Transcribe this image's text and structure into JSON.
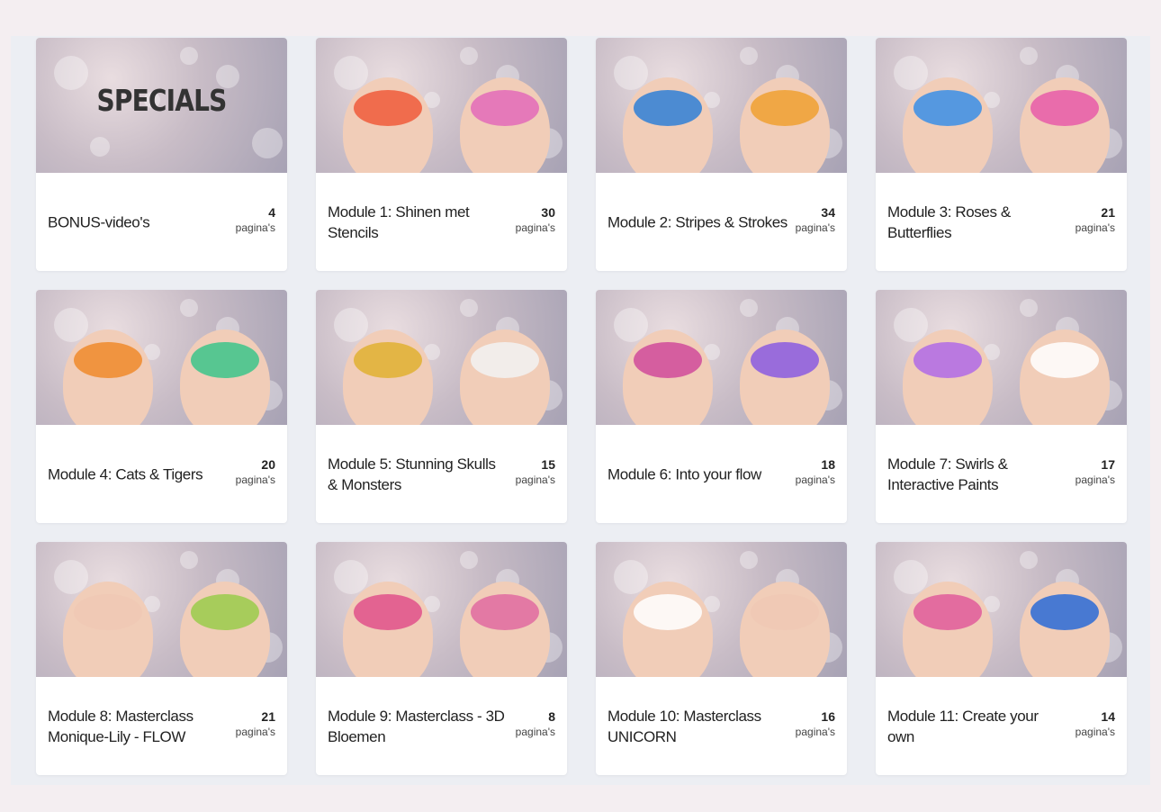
{
  "colors": {
    "page_background": "#f4eef1",
    "panel_background": "#eceef3",
    "card_background": "#ffffff",
    "text": "#222222"
  },
  "cards": [
    {
      "title": "BONUS-video's",
      "count": "4",
      "unit": "pagina's",
      "thumb_text": "SPECIALS",
      "paint": [
        "#ffffff",
        "#ffffff"
      ]
    },
    {
      "title": "Module 1: Shinen met Stencils",
      "count": "30",
      "unit": "pagina's",
      "paint": [
        "#f05a3a",
        "#e36ab8"
      ]
    },
    {
      "title": "Module 2: Stripes & Strokes",
      "count": "34",
      "unit": "pagina's",
      "paint": [
        "#2f7fd6",
        "#f0a030"
      ]
    },
    {
      "title": "Module 3: Roses & Butterflies",
      "count": "21",
      "unit": "pagina's",
      "paint": [
        "#3a8ee6",
        "#e85aa8"
      ]
    },
    {
      "title": "Module 4: Cats & Tigers",
      "count": "20",
      "unit": "pagina's",
      "paint": [
        "#f08a2a",
        "#3cc48a"
      ]
    },
    {
      "title": "Module 5: Stunning Skulls & Monsters",
      "count": "15",
      "unit": "pagina's",
      "paint": [
        "#e0b030",
        "#f2f2f2"
      ]
    },
    {
      "title": "Module 6: Into your flow",
      "count": "18",
      "unit": "pagina's",
      "paint": [
        "#d04a9a",
        "#8a5ae0"
      ]
    },
    {
      "title": "Module 7: Swirls & Interactive Paints",
      "count": "17",
      "unit": "pagina's",
      "paint": [
        "#b06ae6",
        "#ffffff"
      ]
    },
    {
      "title": "Module 8: Masterclass Monique-Lily - FLOW",
      "count": "21",
      "unit": "pagina's",
      "paint": [
        "#f0c8b4",
        "#9acb4a"
      ]
    },
    {
      "title": "Module 9: Masterclass - 3D Bloemen",
      "count": "8",
      "unit": "pagina's",
      "paint": [
        "#e0508a",
        "#e06aa0"
      ]
    },
    {
      "title": "Module 10: Masterclass UNICORN",
      "count": "16",
      "unit": "pagina's",
      "paint": [
        "#ffffff",
        "#f0c8b4"
      ]
    },
    {
      "title": "Module 11: Create your own",
      "count": "14",
      "unit": "pagina's",
      "paint": [
        "#e05a9a",
        "#2a6ad6"
      ]
    }
  ]
}
